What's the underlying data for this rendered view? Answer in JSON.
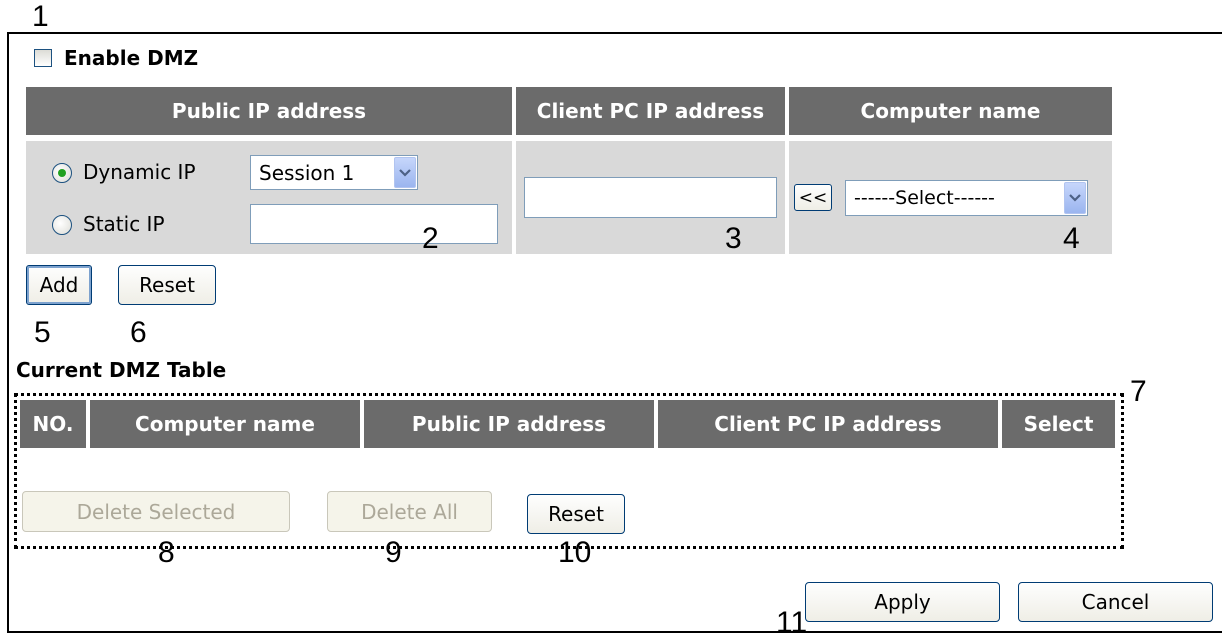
{
  "callouts": [
    "1",
    "2",
    "3",
    "4",
    "5",
    "6",
    "7",
    "8",
    "9",
    "10",
    "11"
  ],
  "enable_dmz": {
    "label": "Enable DMZ",
    "checked": false
  },
  "entry_table": {
    "headers": [
      "Public IP address",
      "Client PC IP address",
      "Computer name"
    ],
    "dynamic_ip": {
      "label": "Dynamic IP",
      "selected": true,
      "session_value": "Session 1"
    },
    "static_ip": {
      "label": "Static IP",
      "selected": false,
      "value": ""
    },
    "client_ip_value": "",
    "copy_button": "<<",
    "computer_select_value": "------Select------"
  },
  "entry_buttons": {
    "add": "Add",
    "reset": "Reset"
  },
  "current_table": {
    "title": "Current DMZ Table",
    "headers": [
      "NO.",
      "Computer name",
      "Public IP address",
      "Client PC IP address",
      "Select"
    ],
    "rows": []
  },
  "table_buttons": {
    "delete_selected": "Delete Selected",
    "delete_all": "Delete All",
    "reset": "Reset"
  },
  "footer_buttons": {
    "apply": "Apply",
    "cancel": "Cancel"
  },
  "colors": {
    "header_bg": "#6b6b6b",
    "cell_bg": "#d9d9d9",
    "radio_dot": "#21a121"
  }
}
